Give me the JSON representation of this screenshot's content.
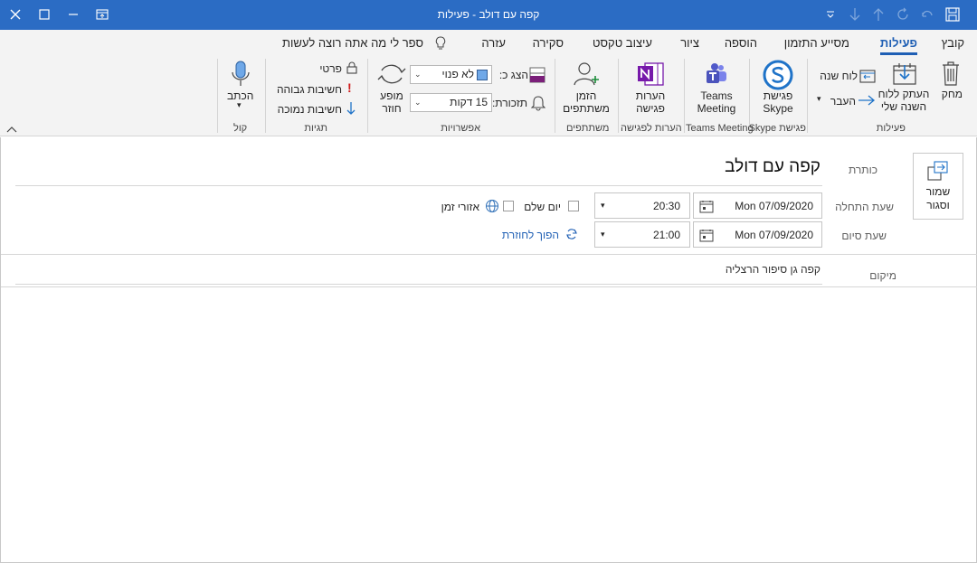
{
  "window": {
    "title": "קפה עם דולב  -  פעילות",
    "accent_color": "#2b6cc4"
  },
  "menu": {
    "tabs": [
      {
        "label": "קובץ"
      },
      {
        "label": "פעילות",
        "active": true
      },
      {
        "label": "מסייע התזמון"
      },
      {
        "label": "הוספה"
      },
      {
        "label": "ציור"
      },
      {
        "label": "עיצוב טקסט"
      },
      {
        "label": "סקירה"
      },
      {
        "label": "עזרה"
      }
    ],
    "tell_me": "ספר לי מה אתה רוצה לעשות"
  },
  "ribbon": {
    "actions": {
      "delete": "מחק",
      "copy_line1": "העתק ללוח",
      "copy_line2": "השנה שלי",
      "calendar": "לוח שנה",
      "forward": "העבר",
      "group": "פעילות"
    },
    "skype": {
      "line1": "פגישת",
      "line2": "Skype",
      "group": "פגישת Skype"
    },
    "teams": {
      "line1": "Teams",
      "line2": "Meeting",
      "group": "Teams Meeting"
    },
    "notes": {
      "line1": "הערות",
      "line2": "פגישה",
      "group": "הערות לפגישה"
    },
    "attendees": {
      "line1": "הזמן",
      "line2": "משתתפים",
      "group": "משתתפים"
    },
    "options": {
      "show_as_label": "הצג כ:",
      "show_as_value": "לא פנוי",
      "reminder_label": "תזכורת:",
      "reminder_value": "15 דקות",
      "recurrence_line1": "מופע",
      "recurrence_line2": "חוזר",
      "group": "אפשרויות"
    },
    "tags": {
      "private": "פרטי",
      "high": "חשיבות גבוהה",
      "low": "חשיבות נמוכה",
      "group": "תגיות"
    },
    "voice": {
      "dictate": "הכתב",
      "group": "קול"
    }
  },
  "form": {
    "save_line1": "שמור",
    "save_line2": "וסגור",
    "subject_label": "כותרת",
    "subject_value": "קפה עם דולב",
    "start_label": "שעת התחלה",
    "start_date": "Mon 07/09/2020",
    "start_time": "20:30",
    "end_label": "שעת סיום",
    "end_date": "Mon 07/09/2020",
    "end_time": "21:00",
    "all_day": "יום שלם",
    "time_zones": "אזורי זמן",
    "make_recurring": "הפוך לחוזרת",
    "location_label": "מיקום",
    "location_value": "קפה גן סיפור הרצליה"
  }
}
